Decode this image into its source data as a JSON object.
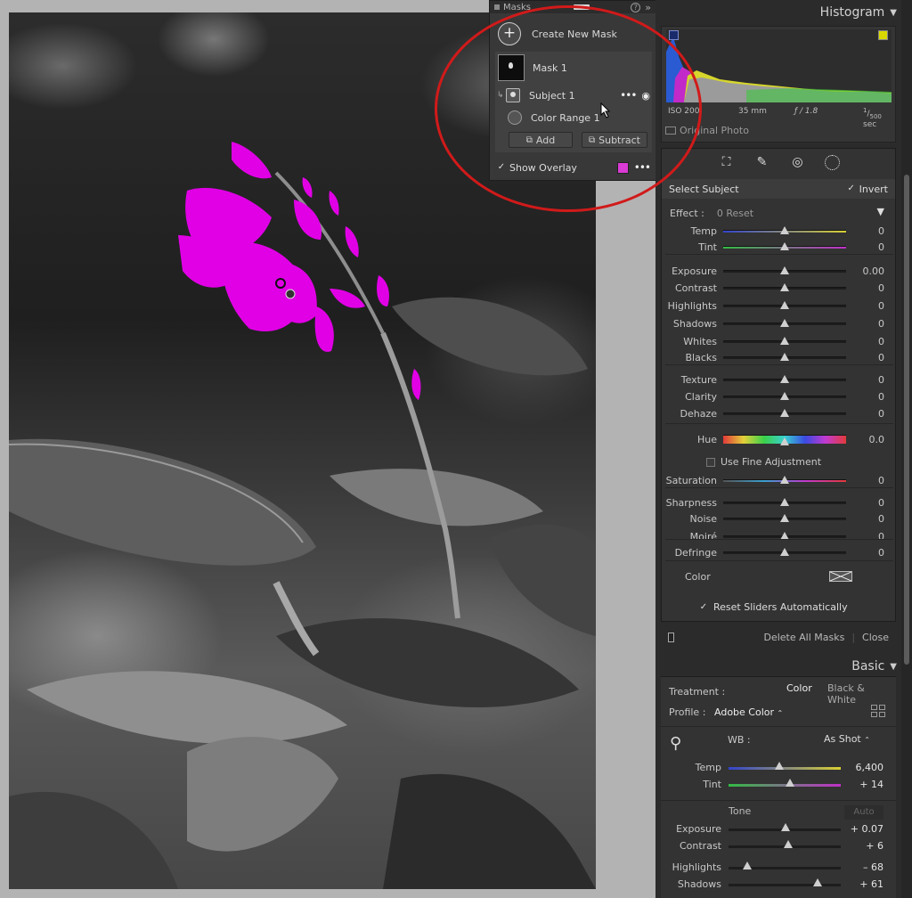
{
  "masks_panel": {
    "title": "Masks",
    "create_new_mask": "Create New Mask",
    "mask_name": "Mask 1",
    "subject_label": "Subject 1",
    "color_range_label": "Color Range 1",
    "add_label": "Add",
    "subtract_label": "Subtract",
    "show_overlay_label": "Show Overlay",
    "overlay_color": "#d93bd4"
  },
  "histogram": {
    "title": "Histogram",
    "iso": "ISO 200",
    "focal": "35 mm",
    "aperture": "ƒ / 1.8",
    "shutter_num": "1",
    "shutter_den": "500",
    "shutter_unit": "sec",
    "original_photo": "Original Photo"
  },
  "mask_tools": {
    "select_subject": "Select Subject",
    "invert_label": "Invert",
    "effect_label": "Effect :",
    "effect_value": "0 Reset",
    "sliders": [
      {
        "label": "Temp",
        "value": "0",
        "pos": 0.5,
        "track": "temp"
      },
      {
        "label": "Tint",
        "value": "0",
        "pos": 0.5,
        "track": "tint"
      },
      {
        "label": "Exposure",
        "value": "0.00",
        "pos": 0.5,
        "track": "plain"
      },
      {
        "label": "Contrast",
        "value": "0",
        "pos": 0.5,
        "track": "plain"
      },
      {
        "label": "Highlights",
        "value": "0",
        "pos": 0.5,
        "track": "plain"
      },
      {
        "label": "Shadows",
        "value": "0",
        "pos": 0.5,
        "track": "plain"
      },
      {
        "label": "Whites",
        "value": "0",
        "pos": 0.5,
        "track": "plain"
      },
      {
        "label": "Blacks",
        "value": "0",
        "pos": 0.5,
        "track": "plain"
      },
      {
        "label": "Texture",
        "value": "0",
        "pos": 0.5,
        "track": "plain"
      },
      {
        "label": "Clarity",
        "value": "0",
        "pos": 0.5,
        "track": "plain"
      },
      {
        "label": "Dehaze",
        "value": "0",
        "pos": 0.5,
        "track": "plain"
      },
      {
        "label": "Hue",
        "value": "0.0",
        "pos": 0.5,
        "track": "hue"
      },
      {
        "label": "Saturation",
        "value": "0",
        "pos": 0.5,
        "track": "sat"
      },
      {
        "label": "Sharpness",
        "value": "0",
        "pos": 0.5,
        "track": "plain"
      },
      {
        "label": "Noise",
        "value": "0",
        "pos": 0.5,
        "track": "plain"
      },
      {
        "label": "Moiré",
        "value": "0",
        "pos": 0.5,
        "track": "plain"
      },
      {
        "label": "Defringe",
        "value": "0",
        "pos": 0.5,
        "track": "plain"
      }
    ],
    "use_fine_adjustment": "Use Fine Adjustment",
    "color_label": "Color",
    "reset_sliders": "Reset Sliders Automatically",
    "delete_all_masks": "Delete All Masks",
    "close_label": "Close"
  },
  "basic": {
    "title": "Basic",
    "treatment_label": "Treatment :",
    "treatment_color": "Color",
    "treatment_bw": "Black & White",
    "profile_label": "Profile :",
    "profile_value": "Adobe Color",
    "wb_label": "WB :",
    "wb_value": "As Shot",
    "tone_label": "Tone",
    "auto_label": "Auto",
    "sliders": [
      {
        "label": "Temp",
        "value": "6,400",
        "pos": 0.45,
        "track": "temp"
      },
      {
        "label": "Tint",
        "value": "+ 14",
        "pos": 0.55,
        "track": "tint"
      },
      {
        "label": "Exposure",
        "value": "+ 0.07",
        "pos": 0.51,
        "track": "plain"
      },
      {
        "label": "Contrast",
        "value": "+ 6",
        "pos": 0.53,
        "track": "plain"
      },
      {
        "label": "Highlights",
        "value": "– 68",
        "pos": 0.17,
        "track": "plain"
      },
      {
        "label": "Shadows",
        "value": "+ 61",
        "pos": 0.79,
        "track": "plain"
      }
    ]
  }
}
